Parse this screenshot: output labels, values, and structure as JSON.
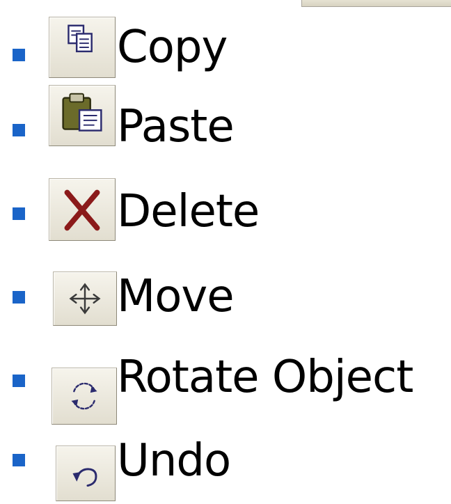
{
  "items": [
    {
      "label": "Copy",
      "icon": "copy-icon"
    },
    {
      "label": "Paste",
      "icon": "paste-icon"
    },
    {
      "label": "Delete",
      "icon": "delete-icon"
    },
    {
      "label": "Move",
      "icon": "move-icon"
    },
    {
      "label": "Rotate Object",
      "icon": "rotate-icon"
    },
    {
      "label": "Undo",
      "icon": "undo-icon"
    }
  ],
  "colors": {
    "bullet": "#1a64c8",
    "delete_x": "#8b1a1a",
    "paste_clipboard": "#6b6b2a",
    "icon_outline": "#3a3a7a"
  }
}
